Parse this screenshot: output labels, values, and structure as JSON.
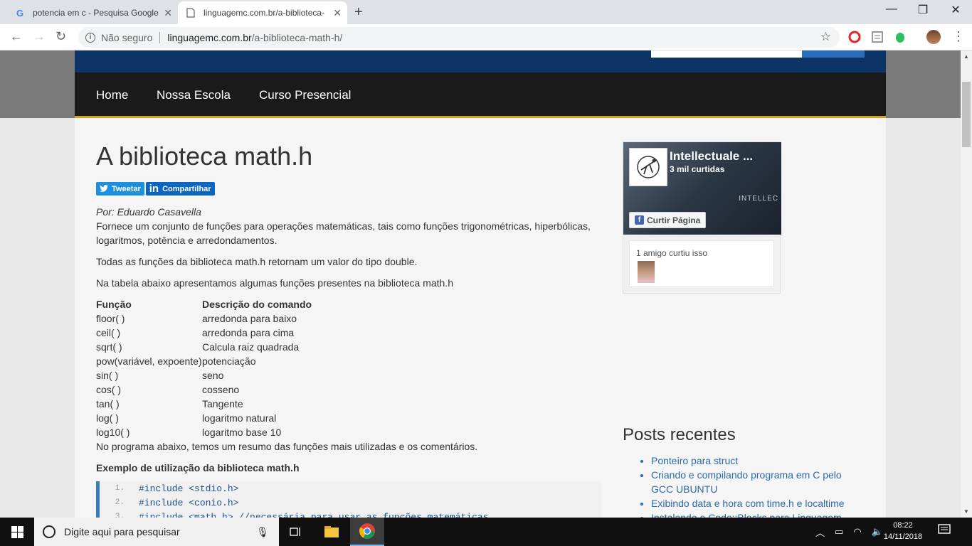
{
  "browser": {
    "tabs": [
      {
        "label": "potencia em c - Pesquisa Google",
        "active": false
      },
      {
        "label": "linguagemc.com.br/a-biblioteca-",
        "active": true
      }
    ],
    "new_tab": "+",
    "window_controls": {
      "minimize": "—",
      "maximize": "❐",
      "close": "✕"
    },
    "omnibox": {
      "security": "Não seguro",
      "url_host": "linguagemc.com.br",
      "url_path": "/a-biblioteca-math-h/"
    }
  },
  "site": {
    "nav": [
      "Home",
      "Nossa Escola",
      "Curso Presencial"
    ],
    "colors": {
      "header": "#0d3466",
      "navbar": "#1a1a1a",
      "accent": "#d4a017",
      "link": "#2d6aa8"
    }
  },
  "article": {
    "title": "A biblioteca math.h",
    "share": {
      "tweet": "Tweetar",
      "linkedin": "Compartilhar"
    },
    "author": "Por: Eduardo Casavella",
    "intro": "Fornece um conjunto de funções para operações matemáticas, tais como funções trigonométricas, hiperbólicas, logaritmos, potência e arredondamentos.",
    "para2": "Todas as funções da biblioteca math.h retornam um valor do tipo double.",
    "para3": "Na tabela abaixo apresentamos algumas funções presentes na biblioteca math.h",
    "table": {
      "headers": [
        "Função",
        "Descrição do comando"
      ],
      "rows": [
        [
          "floor( )",
          "arredonda para baixo"
        ],
        [
          "ceil( )",
          "arredonda para cima"
        ],
        [
          "sqrt( )",
          "Calcula raiz quadrada"
        ],
        [
          "pow(variável, expoente)",
          "potenciação"
        ],
        [
          "sin( )",
          "seno"
        ],
        [
          "cos( )",
          "cosseno"
        ],
        [
          "tan( )",
          "Tangente"
        ],
        [
          "log( )",
          "logaritmo natural"
        ],
        [
          "log10( )",
          "logaritmo base 10"
        ]
      ]
    },
    "para4": "No programa abaixo, temos um resumo das funções mais utilizadas e os comentários.",
    "example_title": "Exemplo de utilização da biblioteca math.h",
    "code": [
      {
        "n": "1.",
        "text": "#include <stdio.h>"
      },
      {
        "n": "2.",
        "text": "#include <conio.h>"
      },
      {
        "n": "3.",
        "text": "#include <math.h> //necessária para usar as funções matemáticas"
      }
    ]
  },
  "sidebar": {
    "facebook": {
      "page_name": "Intellectuale ...",
      "likes": "3 mil curtidas",
      "brand": "INTELLEC",
      "like_button": "Curtir Página",
      "friends": "1 amigo curtiu isso"
    },
    "posts_title": "Posts recentes",
    "posts": [
      "Ponteiro para struct",
      "Criando e compilando programa em C pelo GCC UBUNTU",
      "Exibindo data e hora com time.h e localtime",
      "Instalando o Code::Blocks para Linguagem C no"
    ]
  },
  "taskbar": {
    "search_placeholder": "Digite aqui para pesquisar",
    "time": "08:22",
    "date": "14/11/2018"
  }
}
